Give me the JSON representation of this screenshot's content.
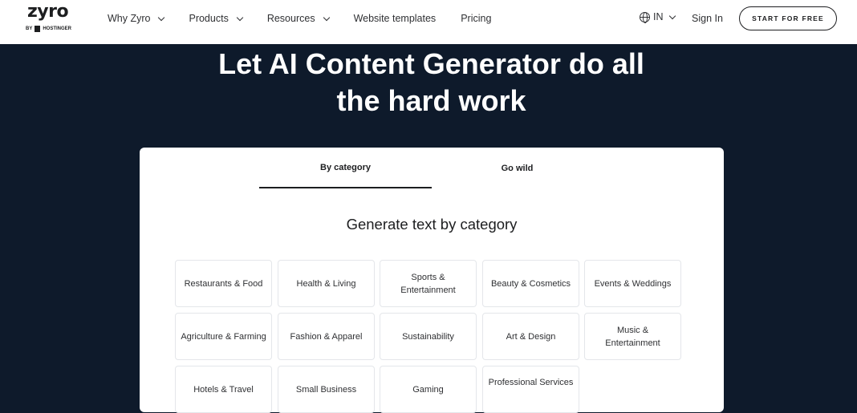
{
  "header": {
    "logo_text": "zyro",
    "logo_by": "BY",
    "logo_brand": "HOSTINGER",
    "nav": [
      {
        "label": "Why Zyro",
        "dropdown": true
      },
      {
        "label": "Products",
        "dropdown": true
      },
      {
        "label": "Resources",
        "dropdown": true
      },
      {
        "label": "Website templates",
        "dropdown": false
      },
      {
        "label": "Pricing",
        "dropdown": false
      }
    ],
    "language": "IN",
    "sign_in": "Sign In",
    "cta": "START FOR FREE"
  },
  "hero": {
    "title_line1": "Let AI Content Generator do all",
    "title_line2": "the hard work"
  },
  "card": {
    "tabs": [
      {
        "label": "By category",
        "active": true
      },
      {
        "label": "Go wild",
        "active": false
      }
    ],
    "section_title": "Generate text by category",
    "categories": [
      "Restaurants & Food",
      "Health & Living",
      "Sports & Entertainment",
      "Beauty & Cosmetics",
      "Events & Weddings",
      "Agriculture & Farming",
      "Fashion & Apparel",
      "Sustainability",
      "Art & Design",
      "Music & Entertainment",
      "Hotels & Travel",
      "Small Business",
      "Gaming",
      "Professional Services"
    ]
  },
  "colors": {
    "hero_bg": "#0e1a2b",
    "text_dark": "#1d1e20",
    "card_border": "#e4e6ea"
  }
}
